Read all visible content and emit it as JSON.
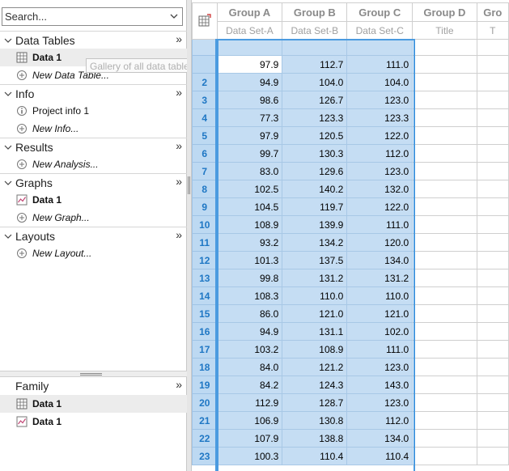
{
  "search": {
    "placeholder": "Search..."
  },
  "tooltip": "Gallery of all data tables",
  "sections": {
    "data_tables": {
      "title": "Data Tables",
      "items": [
        "Data 1",
        "New Data Table..."
      ]
    },
    "info": {
      "title": "Info",
      "items": [
        "Project info 1",
        "New Info..."
      ]
    },
    "results": {
      "title": "Results",
      "items": [
        "New Analysis..."
      ]
    },
    "graphs": {
      "title": "Graphs",
      "items": [
        "Data 1",
        "New Graph..."
      ]
    },
    "layouts": {
      "title": "Layouts",
      "items": [
        "New Layout..."
      ]
    },
    "family": {
      "title": "Family",
      "items": [
        "Data 1",
        "Data 1"
      ]
    }
  },
  "expand_glyph": "»",
  "columns": [
    {
      "group": "Group A",
      "title": "Data Set-A"
    },
    {
      "group": "Group B",
      "title": "Data Set-B"
    },
    {
      "group": "Group C",
      "title": "Data Set-C"
    },
    {
      "group": "Group D",
      "title": "Title"
    },
    {
      "group": "Gro",
      "title": "T"
    }
  ],
  "rows": [
    [
      "97.9",
      "112.7",
      "111.0"
    ],
    [
      "94.9",
      "104.0",
      "104.0"
    ],
    [
      "98.6",
      "126.7",
      "123.0"
    ],
    [
      "77.3",
      "123.3",
      "123.3"
    ],
    [
      "97.9",
      "120.5",
      "122.0"
    ],
    [
      "99.7",
      "130.3",
      "112.0"
    ],
    [
      "83.0",
      "129.6",
      "123.0"
    ],
    [
      "102.5",
      "140.2",
      "132.0"
    ],
    [
      "104.5",
      "119.7",
      "122.0"
    ],
    [
      "108.9",
      "139.9",
      "111.0"
    ],
    [
      "93.2",
      "134.2",
      "120.0"
    ],
    [
      "101.3",
      "137.5",
      "134.0"
    ],
    [
      "99.8",
      "131.2",
      "131.2"
    ],
    [
      "108.3",
      "110.0",
      "110.0"
    ],
    [
      "86.0",
      "121.0",
      "121.0"
    ],
    [
      "94.9",
      "131.1",
      "102.0"
    ],
    [
      "103.2",
      "108.9",
      "111.0"
    ],
    [
      "84.0",
      "121.2",
      "123.0"
    ],
    [
      "84.2",
      "124.3",
      "143.0"
    ],
    [
      "112.9",
      "128.7",
      "123.0"
    ],
    [
      "106.9",
      "130.8",
      "112.0"
    ],
    [
      "107.9",
      "138.8",
      "134.0"
    ],
    [
      "100.3",
      "110.4",
      "110.4"
    ]
  ],
  "colors": {
    "selection": "#c5ddf3",
    "row_number": "#1f77c4",
    "outline": "#4b9be0"
  }
}
